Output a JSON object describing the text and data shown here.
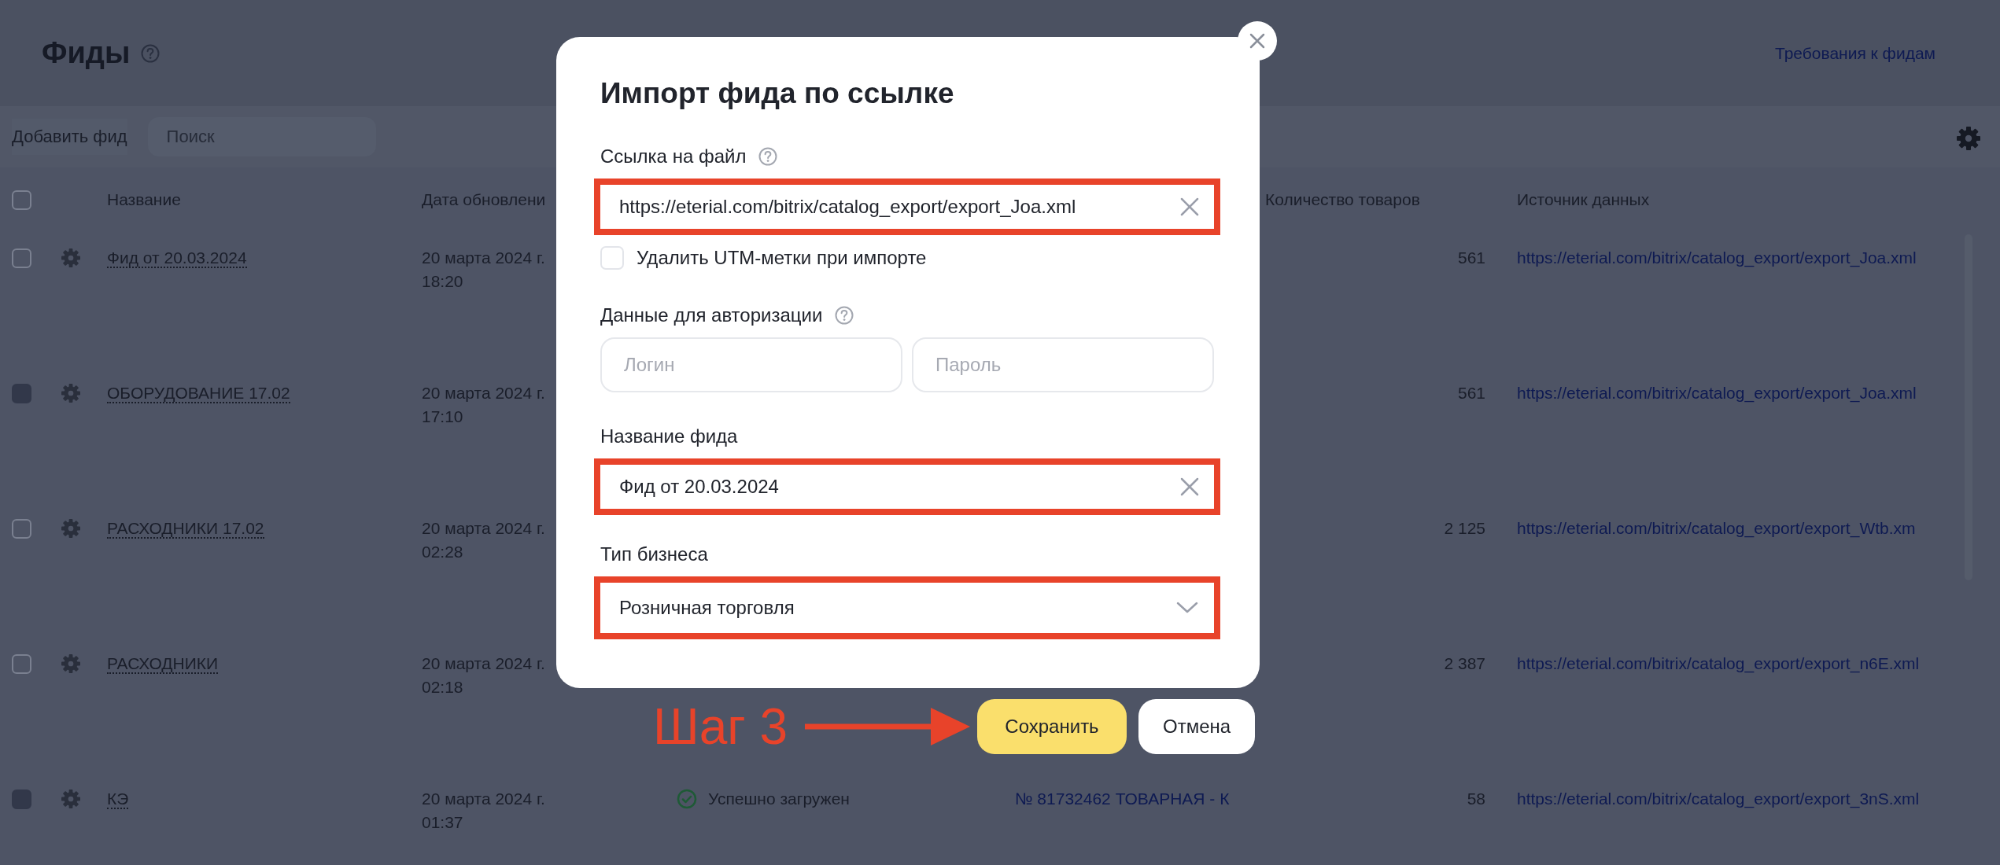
{
  "page": {
    "title": "Фиды",
    "help": true,
    "requirements_link": "Требования к фидам"
  },
  "toolbar": {
    "add_button": "Добавить фид",
    "search": {
      "placeholder": "Поиск"
    },
    "settings": true
  },
  "table": {
    "all_checked": false,
    "columns": [
      "Название",
      "Дата обновлени",
      "Количество товаров",
      "Источник данных"
    ],
    "rows": [
      {
        "name": "Фид от 20.03.2024",
        "date": "20 марта 2024 г.",
        "time": "18:20",
        "count": "561",
        "source": "https://eterial.com/bitrix/catalog_export/export_Joa.xml",
        "disabled": false
      },
      {
        "name": "ОБОРУДОВАНИЕ 17.02",
        "date": "20 марта 2024 г.",
        "time": "17:10",
        "count": "561",
        "source": "https://eterial.com/bitrix/catalog_export/export_Joa.xml",
        "disabled": true
      },
      {
        "name": "РАСХОДНИКИ 17.02",
        "date": "20 марта 2024 г.",
        "time": "02:28",
        "count": "2 125",
        "source": "https://eterial.com/bitrix/catalog_export/export_Wtb.xm",
        "disabled": false
      },
      {
        "name": "РАСХОДНИКИ",
        "date": "20 марта 2024 г.",
        "time": "02:18",
        "count": "2 387",
        "source": "https://eterial.com/bitrix/catalog_export/export_n6E.xml",
        "disabled": false
      },
      {
        "name": "КЭ",
        "date": "20 марта 2024 г.",
        "time": "01:37",
        "status": "Успешно загружен",
        "catalog": "№ 81732462 ТОВАРНАЯ - К",
        "count": "58",
        "source": "https://eterial.com/bitrix/catalog_export/export_3nS.xml",
        "disabled": true
      }
    ]
  },
  "dialog": {
    "title": "Импорт фида по ссылке",
    "fields": [
      {
        "kind": "text",
        "label": "Ссылка на файл",
        "help": true,
        "value": "https://eterial.com/bitrix/catalog_export/export_Joa.xml",
        "clearable": true,
        "highlighted": true
      },
      {
        "kind": "checkbox",
        "label": "Удалить UTM-метки при импорте",
        "checked": false
      },
      {
        "kind": "pair",
        "label": "Данные для авторизации",
        "help": true,
        "inputs": [
          {
            "placeholder": "Логин"
          },
          {
            "placeholder": "Пароль"
          }
        ]
      },
      {
        "kind": "text",
        "label": "Название фида",
        "value": "Фид от 20.03.2024",
        "clearable": true,
        "highlighted": true
      },
      {
        "kind": "select",
        "label": "Тип бизнеса",
        "value": "Розничная торговля",
        "highlighted": true
      }
    ],
    "buttons": [
      {
        "label": "Сохранить",
        "primary": true
      },
      {
        "label": "Отмена",
        "primary": false
      }
    ]
  },
  "annotation": {
    "text": "Шаг 3"
  }
}
